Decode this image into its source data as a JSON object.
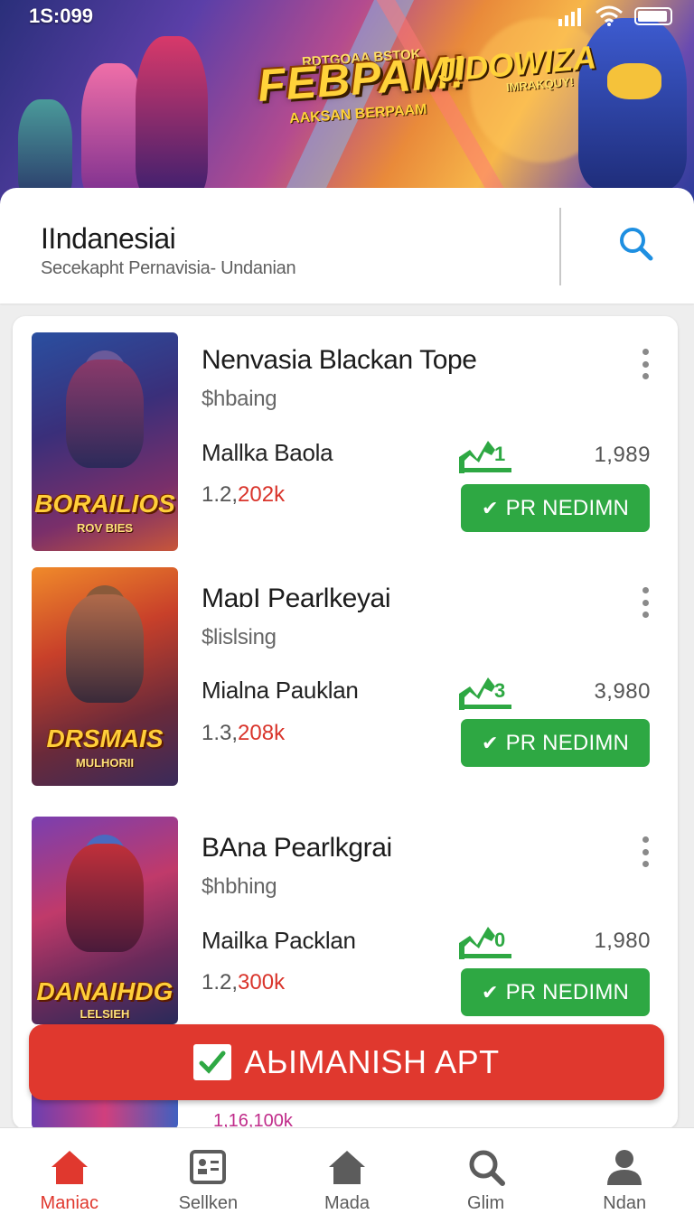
{
  "status_bar": {
    "time": "1S:099"
  },
  "banner": {
    "title_main": "FEBPAM!",
    "title_secondary": "JIDOWIZA",
    "subtitle_top": "RDTGOAA BSTOK",
    "subtitle_bottom": "AAKSAN BERPAAM",
    "subtitle_right": "IMRAKQUY!"
  },
  "header": {
    "title": "IIndanesiai",
    "subtitle": "Secekapht Pernavisia- Undanian"
  },
  "items": [
    {
      "name": "Nenvasia Blackan Tope",
      "price": "$hbaing",
      "developer": "Mallka Baola",
      "downloads_prefix": "1.2,",
      "downloads_highlight": "202k",
      "rank": "1",
      "count": "1,989",
      "action_label": "PR NEDIMN",
      "cover_title": "BORAILIOS",
      "cover_subtitle": "ROV BIES"
    },
    {
      "name": "MaɒI Pearlkeyai",
      "price": "$lislsing",
      "developer": "Mialna Pauklan",
      "downloads_prefix": "1.3,",
      "downloads_highlight": "208k",
      "rank": "3",
      "count": "3,980",
      "action_label": "PR NEDIMN",
      "cover_title": "DRSMAIS",
      "cover_subtitle": "MULHORII"
    },
    {
      "name": "BAna Pearlkgrai",
      "price": "$hbhing",
      "developer": "Mailka Packlan",
      "downloads_prefix": "1.2,",
      "downloads_highlight": "300k",
      "rank": "0",
      "count": "1,980",
      "action_label": "PR NEDIMN",
      "cover_title": "DANAIHDG",
      "cover_subtitle": "LELSIEH"
    }
  ],
  "peek_item": {
    "downloads": "1,16,100k"
  },
  "cta": {
    "label": "AЬIMANISH APT"
  },
  "nav": [
    {
      "label": "Maniac",
      "icon": "home-icon",
      "active": true
    },
    {
      "label": "Sellken",
      "icon": "id-card-icon",
      "active": false
    },
    {
      "label": "Mada",
      "icon": "house-icon",
      "active": false
    },
    {
      "label": "Glim",
      "icon": "search-icon",
      "active": false
    },
    {
      "label": "Ndan",
      "icon": "person-icon",
      "active": false
    }
  ],
  "colors": {
    "accent_red": "#e0382e",
    "action_green": "#2ea843",
    "search_blue": "#1e8fe1"
  }
}
